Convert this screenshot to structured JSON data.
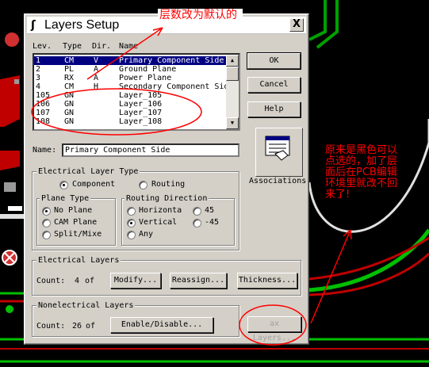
{
  "dialog": {
    "title": "Layers Setup",
    "close_label": "X",
    "list_headers": {
      "lev": "Lev.",
      "type": "Type",
      "dir": "Dir.",
      "name": "Name"
    },
    "layers": [
      {
        "lev": "1",
        "type": "CM",
        "dir": "V",
        "name": "Primary Component Side",
        "selected": true
      },
      {
        "lev": "2",
        "type": "PL",
        "dir": "A",
        "name": "Ground Plane"
      },
      {
        "lev": "3",
        "type": "RX",
        "dir": "A",
        "name": "Power Plane"
      },
      {
        "lev": "4",
        "type": "CM",
        "dir": "H",
        "name": "Secondary Component Side"
      },
      {
        "lev": "105",
        "type": "GN",
        "dir": "",
        "name": "Layer_105"
      },
      {
        "lev": "106",
        "type": "GN",
        "dir": "",
        "name": "Layer_106"
      },
      {
        "lev": "107",
        "type": "GN",
        "dir": "",
        "name": "Layer_107"
      },
      {
        "lev": "108",
        "type": "GN",
        "dir": "",
        "name": "Layer_108"
      }
    ],
    "buttons": {
      "ok": "OK",
      "cancel": "Cancel",
      "help": "Help"
    },
    "associations_label": "Associations",
    "name_label": "Name:",
    "name_value": "Primary Component Side",
    "electrical_layer_type": {
      "title": "Electrical  Layer Type",
      "component": "Component",
      "routing": "Routing",
      "selected": "component"
    },
    "plane_type": {
      "title": "Plane Type",
      "options": [
        "No Plane",
        "CAM Plane",
        "Split/Mixe"
      ],
      "selected": "No Plane"
    },
    "routing_direction": {
      "title": "Routing Direction",
      "horizontal": "Horizonta",
      "d45": "45",
      "vertical": "Vertical",
      "dm45": "-45",
      "any": "Any",
      "selected": "Vertical"
    },
    "electrical_layers": {
      "title": "Electrical Layers",
      "count_label": "Count:",
      "count_value": "4",
      "count_suffix": "of",
      "modify": "Modify...",
      "reassign": "Reassign...",
      "thickness": "Thickness..."
    },
    "nonelectrical_layers": {
      "title": "Nonelectrical Layers",
      "count_label": "Count:",
      "count_value": "26",
      "count_suffix": "of",
      "enable_disable": "Enable/Disable...",
      "max_layers": "ax Layers..."
    }
  },
  "annotations": {
    "top": "层数改为默认的",
    "right": "原来是黑色可以点选的，加了层面后在PCB编辑环境里就改不回来了!"
  },
  "colors": {
    "annotation": "#ff0000",
    "selection": "#000080",
    "dialog_face": "#d4d0c8"
  }
}
